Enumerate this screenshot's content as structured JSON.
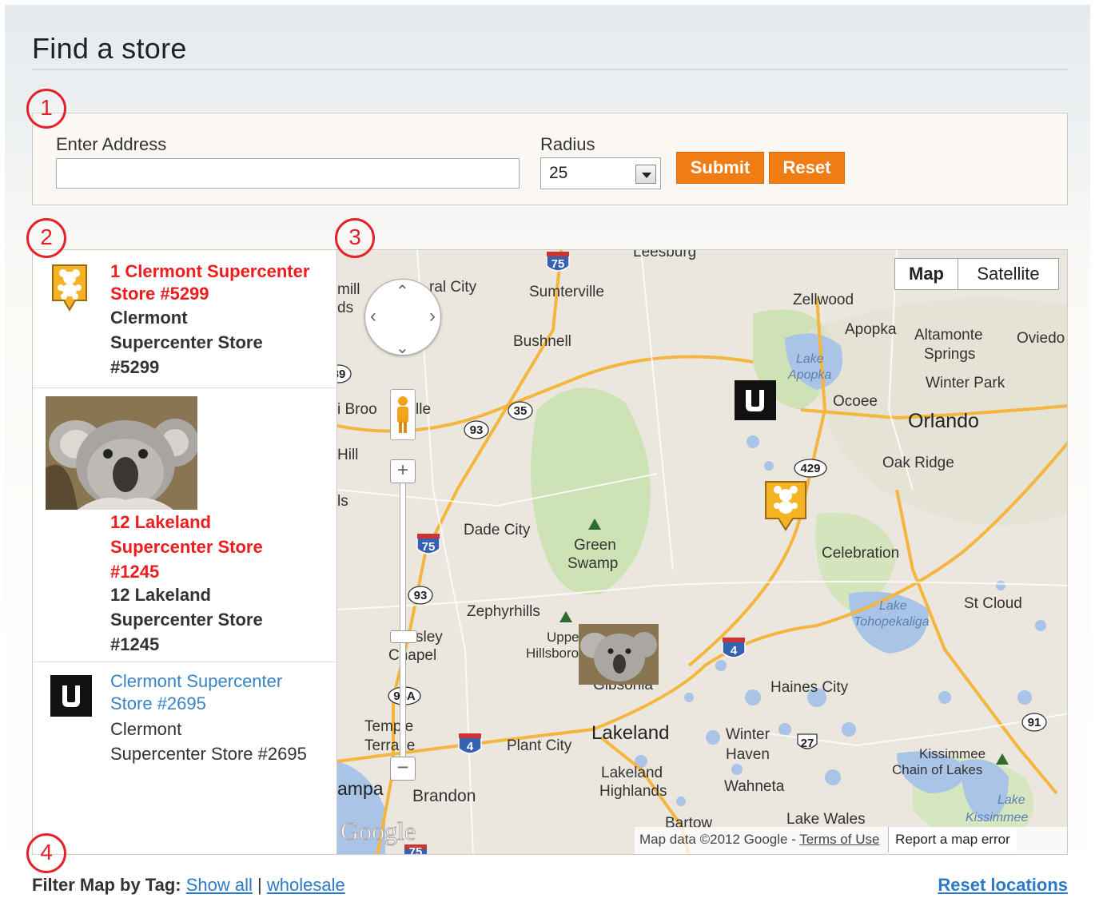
{
  "page": {
    "title": "Find a store"
  },
  "steps": [
    "1",
    "2",
    "3",
    "4"
  ],
  "search": {
    "address_label": "Enter Address",
    "address_value": "",
    "address_placeholder": "",
    "radius_label": "Radius",
    "radius_value": "25",
    "submit_label": "Submit",
    "reset_label": "Reset"
  },
  "stores": [
    {
      "link_lines": [
        "1 Clermont Supercenter",
        "Store #5299"
      ],
      "desc_lines": [
        "Clermont",
        "Supercenter Store",
        "#5299"
      ],
      "icon": "teddy-bear-marker-icon"
    },
    {
      "link_lines": [
        "12 Lakeland",
        "Supercenter Store",
        "#1245"
      ],
      "desc_lines": [
        "12 Lakeland",
        "Supercenter Store",
        "#1245"
      ],
      "icon": "koala-photo"
    },
    {
      "link_lines": [
        "Clermont Supercenter",
        "Store #2695"
      ],
      "desc_lines": [
        "Clermont",
        "Supercenter Store #2695"
      ],
      "icon": "u-logo-icon"
    }
  ],
  "map": {
    "type_buttons": {
      "map": "Map",
      "satellite": "Satellite"
    },
    "attribution": "Map data ©2012 Google -",
    "terms": "Terms of Use",
    "report": "Report a map error",
    "google_logo": "Google",
    "labels": {
      "leesburg": "Leesburg",
      "sumterville": "Sumterville",
      "ral_city": "ral City",
      "mill": "mill",
      "ds": "ds",
      "bushnell": "Bushnell",
      "zellwood": "Zellwood",
      "apopka": "Apopka",
      "altamonte": "Altamonte",
      "springs": "Springs",
      "oviedo": "Oviedo",
      "lake_apopka_1": "Lake",
      "lake_apopka_2": "Apopka",
      "winter_park": "Winter Park",
      "ocoee": "Ocoee",
      "orlando": "Orlando",
      "oak_ridge": "Oak Ridge",
      "brooksville_1": "i Broo",
      "brooksville_2": "lle",
      "hill": "Hill",
      "ls": "ls",
      "dade_city": "Dade City",
      "green": "Green",
      "swamp": "Swamp",
      "celebration": "Celebration",
      "zephyrhills": "Zephyrhills",
      "wesley": "sley",
      "chapel": "Chapel",
      "upper": "Uppe",
      "hillsboro": "Hillsboro",
      "gibsonia": "Gibsonia",
      "lake_toho_1": "Lake",
      "lake_toho_2": "Tohopekaliga",
      "st_cloud": "St Cloud",
      "haines_city": "Haines City",
      "temple": "Temple",
      "terrace": "Terrace",
      "plant_city": "Plant City",
      "lakeland": "Lakeland",
      "winter": "Winter",
      "haven": "Haven",
      "kissimmee": "Kissimmee",
      "chain_of_lakes": "Chain of Lakes",
      "lakeland_highlands_1": "Lakeland",
      "lakeland_highlands_2": "Highlands",
      "wahneta": "Wahneta",
      "tampa": "ampa",
      "brandon": "Brandon",
      "bartow": "Bartow",
      "lake_wales": "Lake Wales",
      "lake_kiss_1": "Lake",
      "lake_kiss_2": "Kissimmee"
    },
    "shields": {
      "i75_top": "75",
      "i75_mid": "75",
      "i75_bot": "75",
      "r35": "35",
      "r93_a": "93",
      "r93_b": "93",
      "r93_c": "93",
      "r89": "89",
      "r429": "429",
      "i4_a": "4",
      "i4_b": "4",
      "r27": "27",
      "r91": "91",
      "r93a": "93A"
    }
  },
  "footer": {
    "filter_label": "Filter Map by Tag:",
    "show_all": "Show all",
    "separator": "|",
    "wholesale": "wholesale",
    "reset_locations": "Reset locations"
  }
}
